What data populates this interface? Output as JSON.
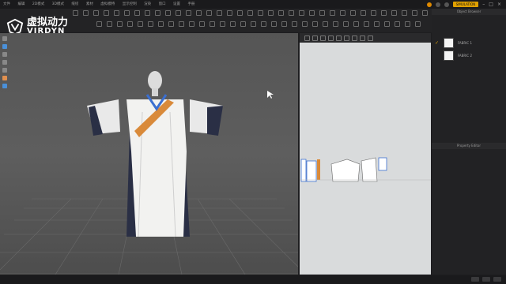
{
  "menu": {
    "items": [
      "文件",
      "编辑",
      "2D模式",
      "3D模式",
      "缝纫",
      "素材",
      "虚拟模特",
      "显示控制",
      "渲染",
      "窗口",
      "设置",
      "手册"
    ]
  },
  "status": {
    "simulation_label": "SIMULATION"
  },
  "logo": {
    "cn": "虚拟动力",
    "en": "VIRDYN"
  },
  "right_panel": {
    "object_browser_title": "Object Browser",
    "fabrics": [
      {
        "label": "FABRIC 1",
        "checked": true
      },
      {
        "label": "FABRIC 2",
        "checked": false
      }
    ],
    "property_editor_title": "Property Editor"
  },
  "colors": {
    "accent": "#e0a000",
    "sash": "#d98a3a",
    "robe": "#f2f2f0",
    "inner_robe": "#2a2f45"
  }
}
